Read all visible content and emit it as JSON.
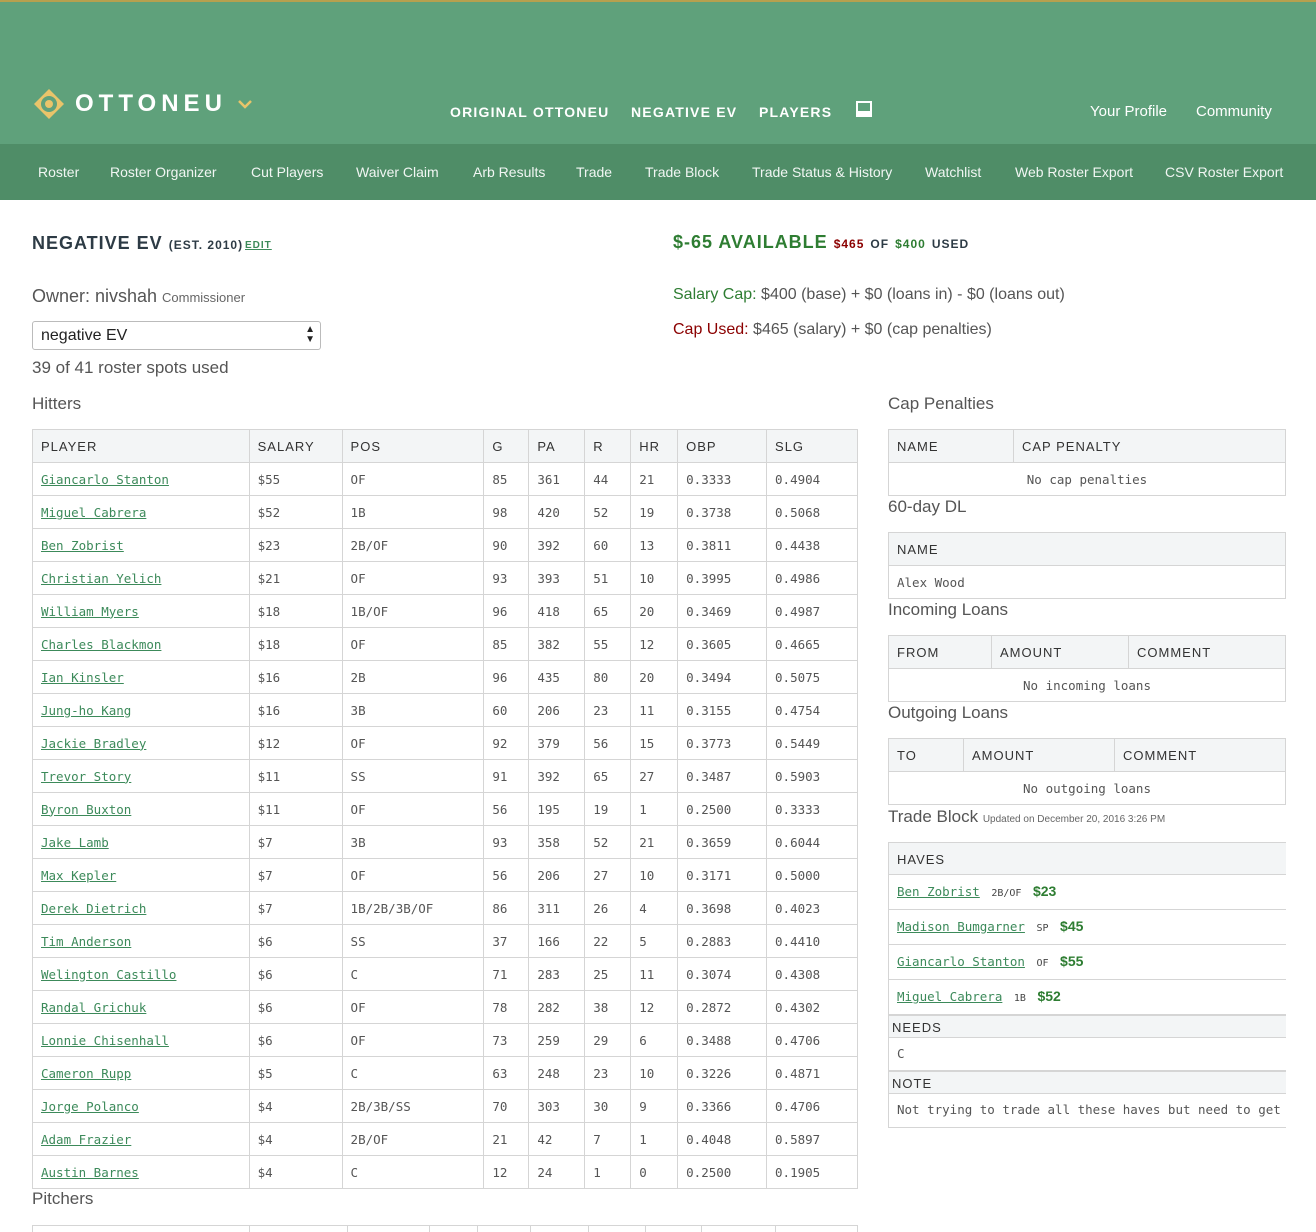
{
  "brand": {
    "name": "OTTONEU"
  },
  "nav": {
    "original": "ORIGINAL OTTONEU",
    "team": "NEGATIVE EV",
    "players": "PLAYERS",
    "profile": "Your Profile",
    "community": "Community"
  },
  "subnav": [
    "Roster",
    "Roster Organizer",
    "Cut Players",
    "Waiver Claim",
    "Arb Results",
    "Trade",
    "Trade Block",
    "Trade Status & History",
    "Watchlist",
    "Web Roster Export",
    "CSV Roster Export"
  ],
  "team": {
    "name": "NEGATIVE EV",
    "est": "(EST. 2010)",
    "edit": "EDIT",
    "owner": "Owner: nivshah",
    "role": "Commissioner",
    "select_value": "negative EV",
    "roster_spots": "39 of 41 roster spots used"
  },
  "cap": {
    "available": "$-65 AVAILABLE",
    "used_amt": "$465",
    "of": "OF",
    "total": "$400",
    "used_word": "USED",
    "salary_label": "Salary Cap:",
    "salary_detail": "$400 (base) + $0 (loans in) - $0 (loans out)",
    "used_label": "Cap Used:",
    "used_detail": "$465 (salary) + $0 (cap penalties)"
  },
  "hitters": {
    "title": "Hitters",
    "columns": [
      "PLAYER",
      "SALARY",
      "POS",
      "G",
      "PA",
      "R",
      "HR",
      "OBP",
      "SLG"
    ],
    "rows": [
      [
        "Giancarlo Stanton",
        "$55",
        "OF",
        "85",
        "361",
        "44",
        "21",
        "0.3333",
        "0.4904"
      ],
      [
        "Miguel Cabrera",
        "$52",
        "1B",
        "98",
        "420",
        "52",
        "19",
        "0.3738",
        "0.5068"
      ],
      [
        "Ben Zobrist",
        "$23",
        "2B/OF",
        "90",
        "392",
        "60",
        "13",
        "0.3811",
        "0.4438"
      ],
      [
        "Christian Yelich",
        "$21",
        "OF",
        "93",
        "393",
        "51",
        "10",
        "0.3995",
        "0.4986"
      ],
      [
        "William Myers",
        "$18",
        "1B/OF",
        "96",
        "418",
        "65",
        "20",
        "0.3469",
        "0.4987"
      ],
      [
        "Charles Blackmon",
        "$18",
        "OF",
        "85",
        "382",
        "55",
        "12",
        "0.3605",
        "0.4665"
      ],
      [
        "Ian Kinsler",
        "$16",
        "2B",
        "96",
        "435",
        "80",
        "20",
        "0.3494",
        "0.5075"
      ],
      [
        "Jung-ho Kang",
        "$16",
        "3B",
        "60",
        "206",
        "23",
        "11",
        "0.3155",
        "0.4754"
      ],
      [
        "Jackie Bradley",
        "$12",
        "OF",
        "92",
        "379",
        "56",
        "15",
        "0.3773",
        "0.5449"
      ],
      [
        "Trevor Story",
        "$11",
        "SS",
        "91",
        "392",
        "65",
        "27",
        "0.3487",
        "0.5903"
      ],
      [
        "Byron Buxton",
        "$11",
        "OF",
        "56",
        "195",
        "19",
        "1",
        "0.2500",
        "0.3333"
      ],
      [
        "Jake Lamb",
        "$7",
        "3B",
        "93",
        "358",
        "52",
        "21",
        "0.3659",
        "0.6044"
      ],
      [
        "Max Kepler",
        "$7",
        "OF",
        "56",
        "206",
        "27",
        "10",
        "0.3171",
        "0.5000"
      ],
      [
        "Derek Dietrich",
        "$7",
        "1B/2B/3B/OF",
        "86",
        "311",
        "26",
        "4",
        "0.3698",
        "0.4023"
      ],
      [
        "Tim Anderson",
        "$6",
        "SS",
        "37",
        "166",
        "22",
        "5",
        "0.2883",
        "0.4410"
      ],
      [
        "Welington Castillo",
        "$6",
        "C",
        "71",
        "283",
        "25",
        "11",
        "0.3074",
        "0.4308"
      ],
      [
        "Randal Grichuk",
        "$6",
        "OF",
        "78",
        "282",
        "38",
        "12",
        "0.2872",
        "0.4302"
      ],
      [
        "Lonnie Chisenhall",
        "$6",
        "OF",
        "73",
        "259",
        "29",
        "6",
        "0.3488",
        "0.4706"
      ],
      [
        "Cameron Rupp",
        "$5",
        "C",
        "63",
        "248",
        "23",
        "10",
        "0.3226",
        "0.4871"
      ],
      [
        "Jorge Polanco",
        "$4",
        "2B/3B/SS",
        "70",
        "303",
        "30",
        "9",
        "0.3366",
        "0.4706"
      ],
      [
        "Adam Frazier",
        "$4",
        "2B/OF",
        "21",
        "42",
        "7",
        "1",
        "0.4048",
        "0.5897"
      ],
      [
        "Austin Barnes",
        "$4",
        "C",
        "12",
        "24",
        "1",
        "0",
        "0.2500",
        "0.1905"
      ]
    ]
  },
  "pitchers": {
    "title": "Pitchers"
  },
  "cap_penalties": {
    "title": "Cap Penalties",
    "col_name": "NAME",
    "col_penalty": "CAP PENALTY",
    "empty": "No cap penalties"
  },
  "dl60": {
    "title": "60-day DL",
    "col_name": "NAME",
    "player": "Alex Wood"
  },
  "incoming": {
    "title": "Incoming Loans",
    "col_from": "FROM",
    "col_amount": "AMOUNT",
    "col_comment": "COMMENT",
    "empty": "No incoming loans"
  },
  "outgoing": {
    "title": "Outgoing Loans",
    "col_to": "TO",
    "col_amount": "AMOUNT",
    "col_comment": "COMMENT",
    "empty": "No outgoing loans"
  },
  "trade_block": {
    "title": "Trade Block",
    "updated": "Updated on December 20, 2016 3:26 PM",
    "haves_label": "HAVES",
    "haves": [
      {
        "name": "Ben Zobrist",
        "pos": "2B/OF",
        "salary": "$23"
      },
      {
        "name": "Madison Bumgarner",
        "pos": "SP",
        "salary": "$45"
      },
      {
        "name": "Giancarlo Stanton",
        "pos": "OF",
        "salary": "$55"
      },
      {
        "name": "Miguel Cabrera",
        "pos": "1B",
        "salary": "$52"
      }
    ],
    "needs_label": "NEEDS",
    "needs": "C",
    "note_label": "NOTE",
    "note": "Not trying to trade all these haves but need to get a C"
  },
  "colors": {
    "header": "#5fa17b",
    "subnav": "#4f8d67",
    "link": "#3c8a5a",
    "cap_green": "#2e7d32",
    "cap_red": "#8b0000",
    "logo": "#e9c46a"
  },
  "icons": [
    "ottoneu-logo-icon",
    "chevron-down-icon",
    "inbox-icon",
    "select-arrows-icon"
  ]
}
